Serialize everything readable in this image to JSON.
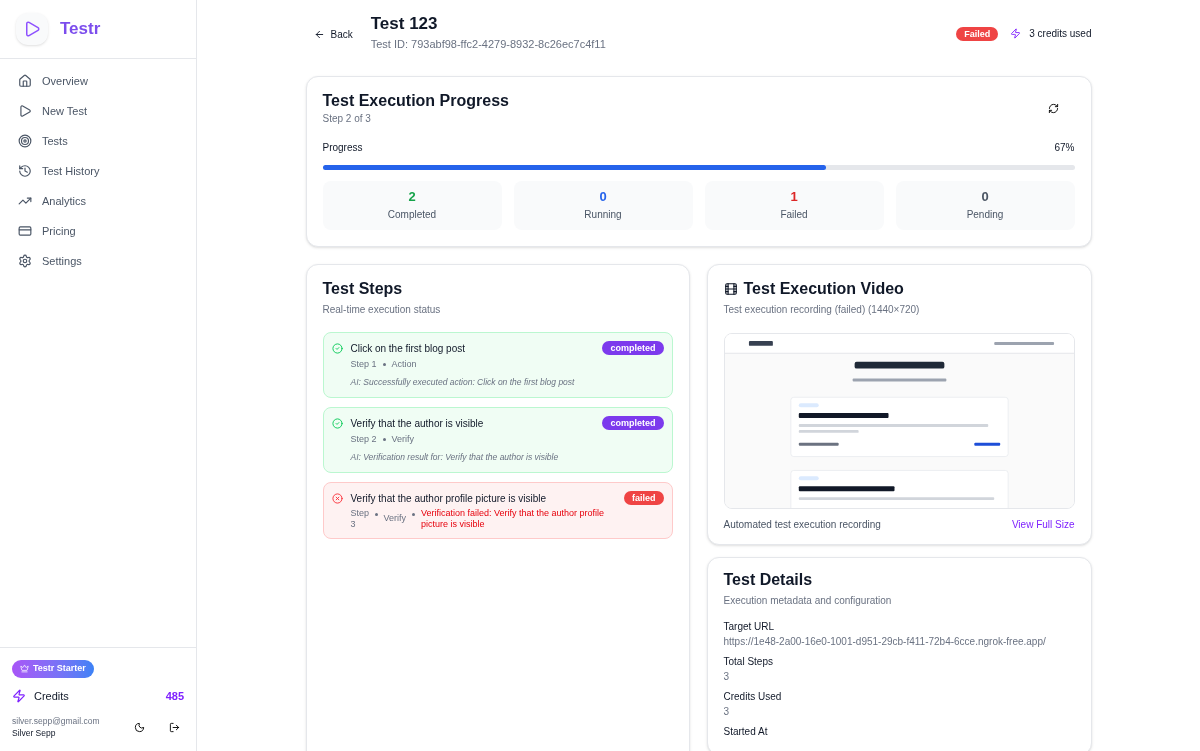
{
  "sidebar": {
    "brand": "Testr",
    "items": [
      {
        "label": "Overview"
      },
      {
        "label": "New Test"
      },
      {
        "label": "Tests"
      },
      {
        "label": "Test History"
      },
      {
        "label": "Analytics"
      },
      {
        "label": "Pricing"
      },
      {
        "label": "Settings"
      }
    ],
    "plan": "Testr Starter",
    "credits_label": "Credits",
    "credits_value": "485",
    "email": "silver.sepp@gmail.com",
    "user": "Silver Sepp"
  },
  "header": {
    "back": "Back",
    "title": "Test 123",
    "test_id": "Test ID: 793abf98-ffc2-4279-8932-8c26ec7c4f11",
    "status": "Failed",
    "credits": "3 credits used"
  },
  "progress_card": {
    "title": "Test Execution Progress",
    "subtitle": "Step 2 of 3",
    "label": "Progress",
    "percent": "67%",
    "level": 0.67,
    "stats": [
      {
        "value": "2",
        "label": "Completed",
        "color": "#16a34a"
      },
      {
        "value": "0",
        "label": "Running",
        "color": "#2563eb"
      },
      {
        "value": "1",
        "label": "Failed",
        "color": "#dc2626"
      },
      {
        "value": "0",
        "label": "Pending",
        "color": "#4b5563"
      }
    ]
  },
  "steps_card": {
    "title": "Test Steps",
    "subtitle": "Real-time execution status",
    "steps": [
      {
        "title": "Click on the first blog post",
        "step": "Step 1",
        "type": "Action",
        "status": "completed",
        "kind": "completed",
        "note": "AI: Successfully executed action: Click on the first blog post"
      },
      {
        "title": "Verify that the author is visible",
        "step": "Step 2",
        "type": "Verify",
        "status": "completed",
        "kind": "completed",
        "note": "AI: Verification result for: Verify that the author is visible"
      },
      {
        "title": "Verify that the author profile picture is visible",
        "step": "Step 3",
        "type": "Verify",
        "status": "failed",
        "kind": "failed",
        "note": "Verification failed: Verify that the author profile picture is visible"
      }
    ]
  },
  "video_card": {
    "title": "Test Execution Video",
    "subtitle": "Test execution recording (failed) (1440×720)",
    "caption": "Automated test execution recording",
    "link": "View Full Size"
  },
  "details_card": {
    "title": "Test Details",
    "subtitle": "Execution metadata and configuration",
    "fields": [
      {
        "label": "Target URL",
        "value": "https://1e48-2a00-16e0-1001-d951-29cb-f411-72b4-6cce.ngrok-free.app/"
      },
      {
        "label": "Total Steps",
        "value": "3"
      },
      {
        "label": "Credits Used",
        "value": "3"
      },
      {
        "label": "Started At"
      }
    ]
  }
}
